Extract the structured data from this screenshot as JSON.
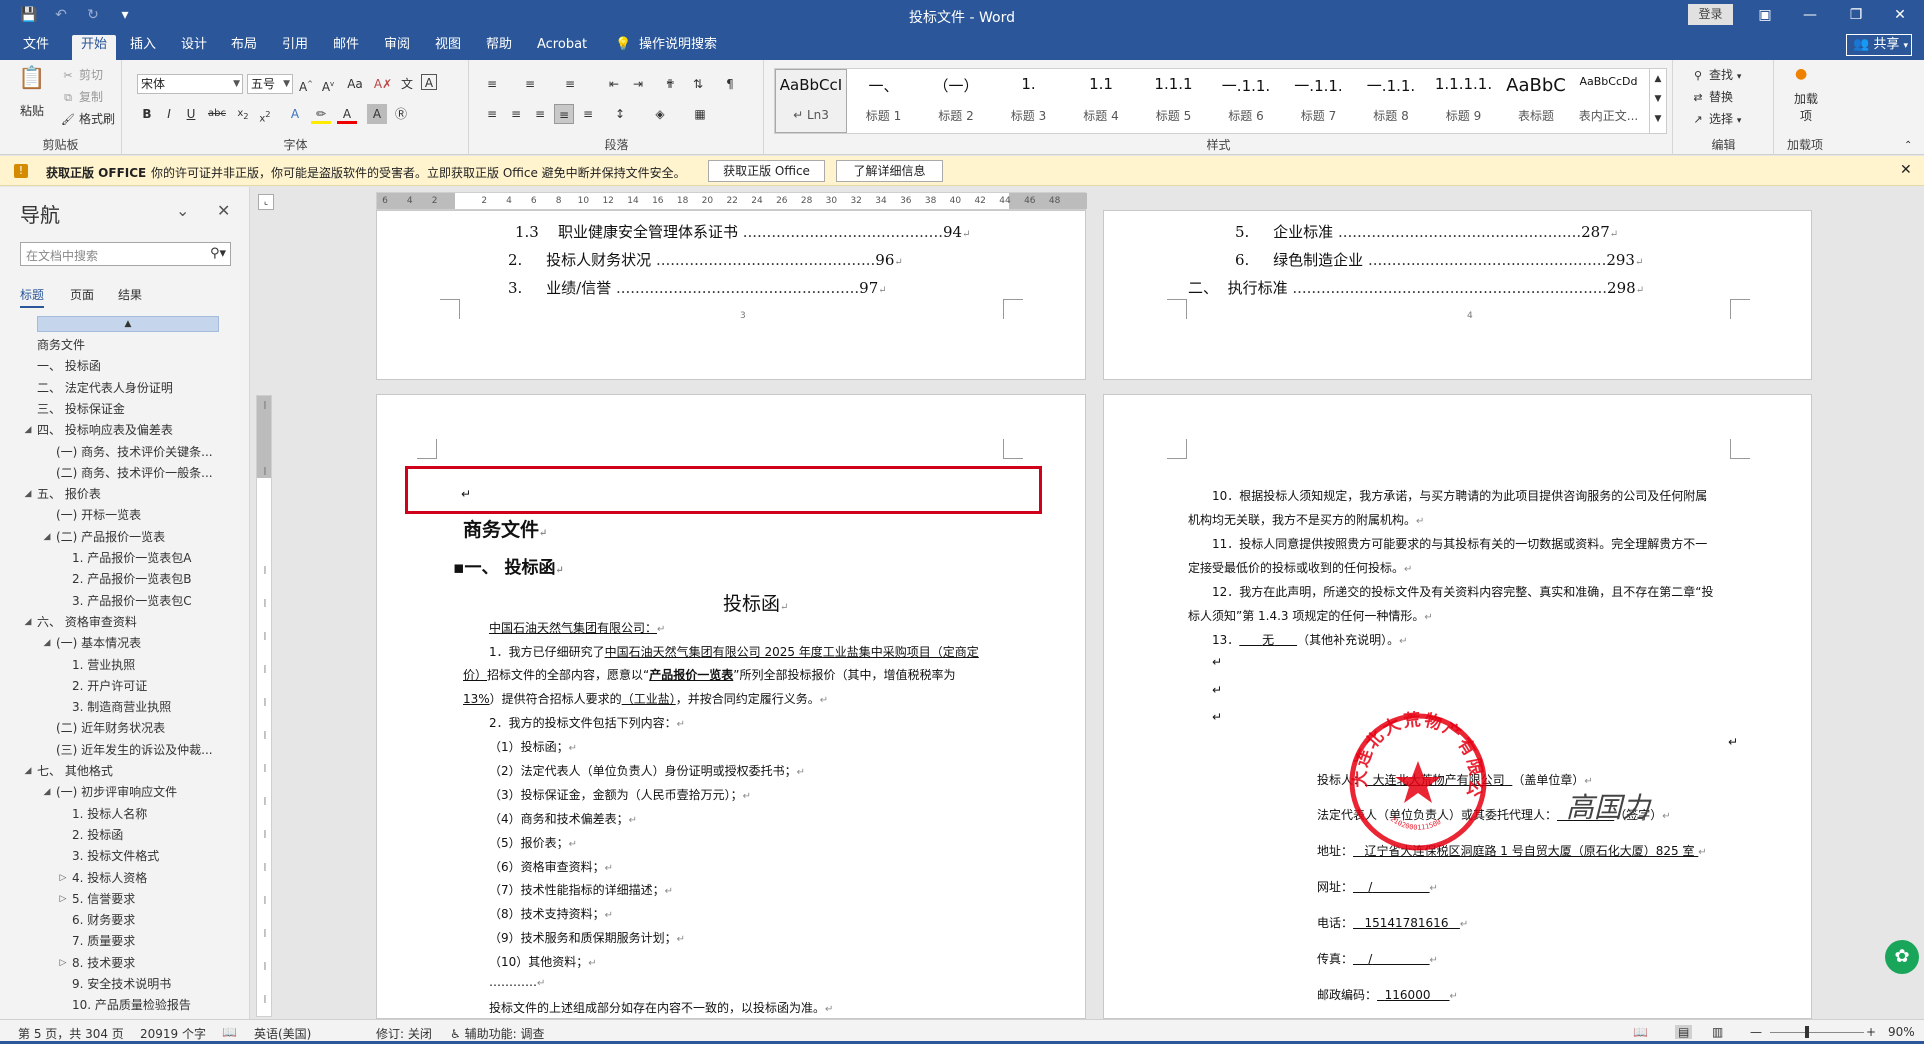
{
  "titlebar": {
    "title": "投标文件 - Word",
    "login": "登录"
  },
  "tabs": [
    "文件",
    "开始",
    "插入",
    "设计",
    "布局",
    "引用",
    "邮件",
    "审阅",
    "视图",
    "帮助",
    "Acrobat",
    "操作说明搜索"
  ],
  "active_tab": "开始",
  "share_label": "共享",
  "ribbon": {
    "clipboard": {
      "paste": "粘贴",
      "cut": "剪切",
      "copy": "复制",
      "format_painter": "格式刷",
      "label": "剪贴板"
    },
    "font": {
      "name": "宋体",
      "size": "五号",
      "label": "字体"
    },
    "paragraph": {
      "label": "段落"
    },
    "styles": {
      "label": "样式",
      "items": [
        {
          "sample": "AaBbCcI",
          "name": "↵ Ln3"
        },
        {
          "sample": "一、",
          "name": "标题 1"
        },
        {
          "sample": "（一）",
          "name": "标题 2"
        },
        {
          "sample": "1.",
          "name": "标题 3"
        },
        {
          "sample": "1.1",
          "name": "标题 4"
        },
        {
          "sample": "1.1.1",
          "name": "标题 5"
        },
        {
          "sample": "一.1.1.",
          "name": "标题 6"
        },
        {
          "sample": "一.1.1.",
          "name": "标题 7"
        },
        {
          "sample": "一.1.1.",
          "name": "标题 8"
        },
        {
          "sample": "1.1.1.1.",
          "name": "标题 9"
        },
        {
          "sample": "AaBbC",
          "name": "表标题"
        },
        {
          "sample": "AaBbCcDd",
          "name": "表内正文..."
        }
      ]
    },
    "editing": {
      "find": "查找",
      "replace": "替换",
      "select": "选择",
      "label": "编辑"
    },
    "addins": {
      "add": "加载项",
      "label": "加载项"
    }
  },
  "warning": {
    "title": "获取正版 OFFICE",
    "message": "你的许可证并非正版，你可能是盗版软件的受害者。立即获取正版 Office 避免中断并保持文件安全。",
    "btn1": "获取正版 Office",
    "btn2": "了解详细信息"
  },
  "nav": {
    "title": "导航",
    "search_placeholder": "在文档中搜索",
    "tabs": [
      "标题",
      "页面",
      "结果"
    ],
    "items": [
      {
        "label": "商务文件",
        "level": 0,
        "tw": ""
      },
      {
        "label": "一、 投标函",
        "level": 0,
        "tw": ""
      },
      {
        "label": "二、 法定代表人身份证明",
        "level": 0,
        "tw": ""
      },
      {
        "label": "三、 投标保证金",
        "level": 0,
        "tw": ""
      },
      {
        "label": "四、 投标响应表及偏差表",
        "level": 0,
        "tw": "◢"
      },
      {
        "label": "(一) 商务、技术评价关键条...",
        "level": 1,
        "tw": ""
      },
      {
        "label": "(二) 商务、技术评价一般条...",
        "level": 1,
        "tw": ""
      },
      {
        "label": "五、 报价表",
        "level": 0,
        "tw": "◢"
      },
      {
        "label": "(一) 开标一览表",
        "level": 1,
        "tw": ""
      },
      {
        "label": "(二) 产品报价一览表",
        "level": 1,
        "tw": "◢"
      },
      {
        "label": "1. 产品报价一览表包A",
        "level": 2,
        "tw": ""
      },
      {
        "label": "2. 产品报价一览表包B",
        "level": 2,
        "tw": ""
      },
      {
        "label": "3. 产品报价一览表包C",
        "level": 2,
        "tw": ""
      },
      {
        "label": "六、 资格审查资料",
        "level": 0,
        "tw": "◢"
      },
      {
        "label": "(一) 基本情况表",
        "level": 1,
        "tw": "◢"
      },
      {
        "label": "1. 营业执照",
        "level": 2,
        "tw": ""
      },
      {
        "label": "2. 开户许可证",
        "level": 2,
        "tw": ""
      },
      {
        "label": "3. 制造商营业执照",
        "level": 2,
        "tw": ""
      },
      {
        "label": "(二) 近年财务状况表",
        "level": 1,
        "tw": ""
      },
      {
        "label": "(三) 近年发生的诉讼及仲裁...",
        "level": 1,
        "tw": ""
      },
      {
        "label": "七、 其他格式",
        "level": 0,
        "tw": "◢"
      },
      {
        "label": "(一) 初步评审响应文件",
        "level": 1,
        "tw": "◢"
      },
      {
        "label": "1. 投标人名称",
        "level": 2,
        "tw": ""
      },
      {
        "label": "2. 投标函",
        "level": 2,
        "tw": ""
      },
      {
        "label": "3. 投标文件格式",
        "level": 2,
        "tw": ""
      },
      {
        "label": "4. 投标人资格",
        "level": 2,
        "tw": "▷"
      },
      {
        "label": "5. 信誉要求",
        "level": 2,
        "tw": "▷"
      },
      {
        "label": "6. 财务要求",
        "level": 2,
        "tw": ""
      },
      {
        "label": "7. 质量要求",
        "level": 2,
        "tw": ""
      },
      {
        "label": "8. 技术要求",
        "level": 2,
        "tw": "▷"
      },
      {
        "label": "9. 安全技术说明书",
        "level": 2,
        "tw": ""
      },
      {
        "label": "10. 产品质量检验报告",
        "level": 2,
        "tw": ""
      }
    ]
  },
  "ruler_ticks": [
    "6",
    "4",
    "2",
    "",
    "2",
    "4",
    "6",
    "8",
    "10",
    "12",
    "14",
    "16",
    "18",
    "20",
    "22",
    "24",
    "26",
    "28",
    "30",
    "32",
    "34",
    "36",
    "38",
    "40",
    "42",
    "44",
    "46",
    "48"
  ],
  "page3": {
    "lines": [
      {
        "num": "1.3",
        "text": "职业健康安全管理体系证书",
        "page": "94"
      },
      {
        "num": "2.",
        "text": "投标人财务状况",
        "page": "96"
      },
      {
        "num": "3.",
        "text": "业绩/信誉",
        "page": "97"
      }
    ],
    "footer": "3"
  },
  "page4": {
    "lines": [
      {
        "num": "5.",
        "text": "企业标准",
        "page": "287"
      },
      {
        "num": "6.",
        "text": "绿色制造企业",
        "page": "293"
      },
      {
        "num": "二、",
        "text": "执行标准",
        "page": "298"
      }
    ],
    "footer": "4"
  },
  "page5": {
    "title": "商务文件",
    "heading": "一、 投标函",
    "center_title": "投标函",
    "addressee": "中国石油天然气集团有限公司：",
    "p1a": "1．我方已仔细研究了",
    "p1b": "中国石油天然气集团有限公司 2025 年度工业盐集中采购项目（定商定",
    "p1c": "价）",
    "p1d": "招标文件的全部内容，愿意以“",
    "p1e": "产品报价一览表",
    "p1f": "”所列全部投标报价（其中，增值税税率为",
    "p1g": "13%",
    "p1h": "）提供符合招标人要求的",
    "p1i": "（工业盐）",
    "p1j": "，并按合同约定履行义务。",
    "p2": "2．我方的投标文件包括下列内容：",
    "items": [
      "（1）投标函；",
      "（2）法定代表人（单位负责人）身份证明或授权委托书；",
      "（3）投标保证金，金额为（人民币壹拾万元）；",
      "（4）商务和技术偏差表；",
      "（5）报价表；",
      "（6）资格审查资料；",
      "（7）技术性能指标的详细描述；",
      "（8）技术支持资料；",
      "（9）技术服务和质保期服务计划；",
      "（10）其他资料；"
    ],
    "dots": "…………",
    "last": "投标文件的上述组成部分如存在内容不一致的，以投标函为准。"
  },
  "page6": {
    "p10a": "10．根据投标人须知规定，我方承诺，与买方聘请的为此项目提供咨询服务的公司及任何附属",
    "p10b": "机构均无关联，我方不是买方的附属机构。",
    "p11a": "11．投标人同意提供按照贵方可能要求的与其投标有关的一切数据或资料。完全理解贵方不一",
    "p11b": "定接受最低价的投标或收到的任何投标。",
    "p12a": "12．我方在此声明，所递交的投标文件及有关资料内容完整、真实和准确，且不存在第二章“投",
    "p12b": "标人须知”第 1.4.3 项规定的任何一种情形。",
    "p13a": "13．",
    "p13b": "无",
    "p13c": "（其他补充说明）。",
    "bidder_label": "投标人：",
    "bidder_value": "大连北大荒物产有限公司",
    "bidder_suffix": "（盖单位章）",
    "rep_label": "法定代表人（单位负责人）或其委托代理人：",
    "rep_suffix": "（签字）",
    "addr_label": "地址：",
    "addr_value": "辽宁省大连保税区洞庭路 1 号自贸大厦（原石化大厦）825 室",
    "web_label": "网址：",
    "web_value": "/",
    "tel_label": "电话：",
    "tel_value": "15141781616",
    "fax_label": "传真：",
    "fax_value": "/",
    "zip_label": "邮政编码：",
    "zip_value": "116000",
    "stamp_text": "大连北大荒物产有限公司",
    "stamp_code": "2102000111500",
    "signature": "高国力"
  },
  "status": {
    "page": "第 5 页，共 304 页",
    "words": "20919 个字",
    "lang": "英语(美国)",
    "track": "修订: 关闭",
    "access": "辅助功能: 调查",
    "zoom": "90%"
  }
}
